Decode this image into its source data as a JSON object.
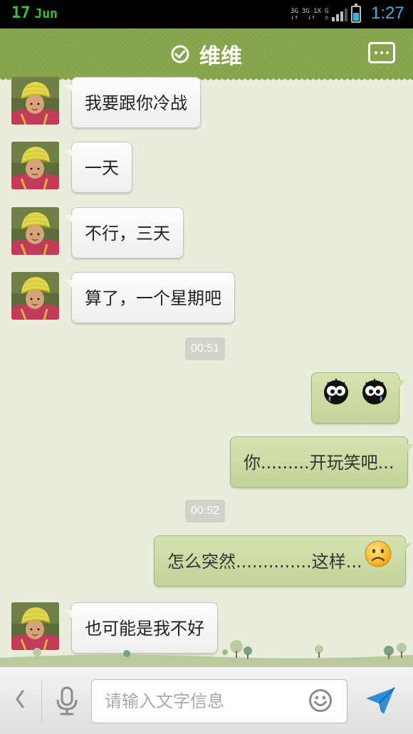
{
  "status_bar": {
    "day": "17",
    "month": "Jun",
    "network_labels": [
      "3G",
      "3G 1X",
      "G"
    ],
    "battery_level": 0.6,
    "time": "1:27",
    "colors": {
      "date": "#38c338",
      "time": "#33b5e5"
    }
  },
  "header": {
    "title": "维维",
    "check_icon": "check-circle-icon",
    "menu_icon": "more-options-icon",
    "color": "#86a34a"
  },
  "messages": [
    {
      "side": "in",
      "text": "我要跟你冷战"
    },
    {
      "side": "in",
      "text": "一天"
    },
    {
      "side": "in",
      "text": "不行，三天"
    },
    {
      "side": "in",
      "text": "算了，一个星期吧"
    },
    {
      "side": "time",
      "text": "00:51"
    },
    {
      "side": "out",
      "text": "",
      "emoji": [
        "crying-face-icon",
        "crying-face-icon"
      ]
    },
    {
      "side": "out",
      "text": "你.........开玩笑吧..."
    },
    {
      "side": "time",
      "text": "00:52"
    },
    {
      "side": "out",
      "text": "怎么突然..............这样...",
      "emoji": [
        "frown-face-icon"
      ]
    },
    {
      "side": "in",
      "text": "也可能是我不好"
    }
  ],
  "input_bar": {
    "placeholder": "请输入文字信息",
    "value": "",
    "icons": [
      "chevron-left-icon",
      "microphone-icon",
      "smiley-icon",
      "send-icon"
    ]
  }
}
